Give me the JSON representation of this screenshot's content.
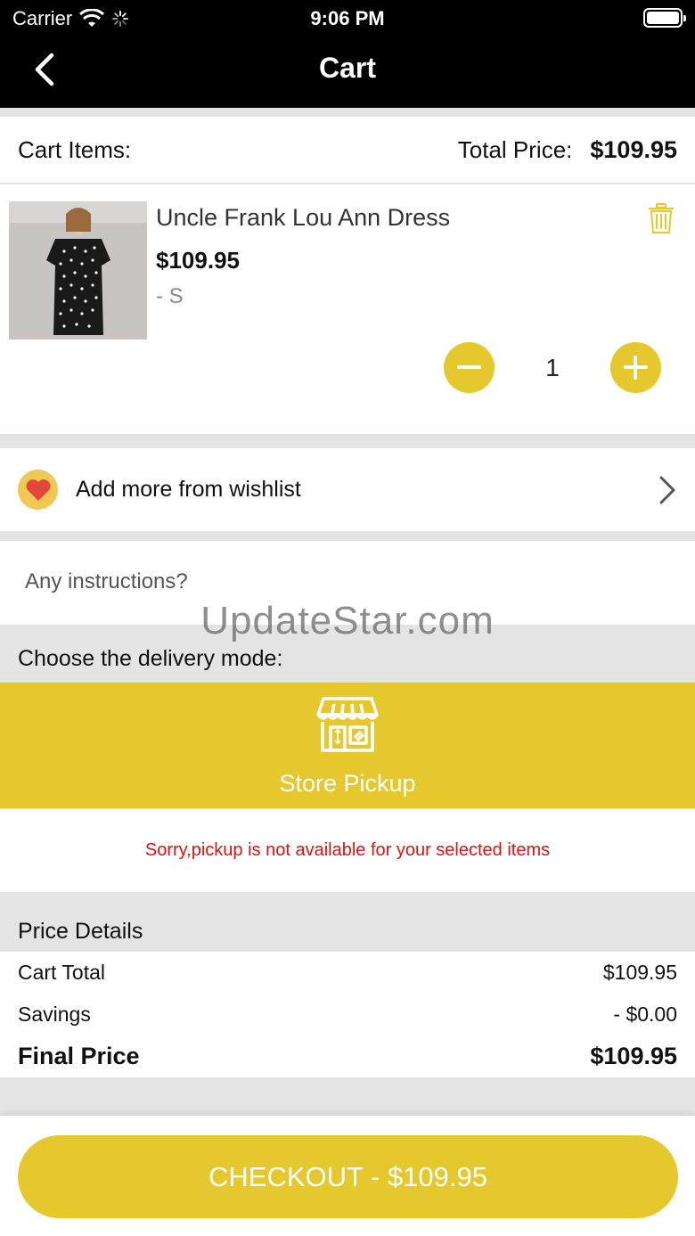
{
  "status_bar": {
    "carrier": "Carrier",
    "time": "9:06 PM"
  },
  "nav": {
    "title": "Cart"
  },
  "cart_header": {
    "label": "Cart Items:",
    "total_label": "Total Price:",
    "total_value": "$109.95"
  },
  "item": {
    "name": "Uncle Frank Lou Ann Dress",
    "price": "$109.95",
    "variant": "- S",
    "quantity": "1"
  },
  "wishlist": {
    "label": "Add more from wishlist"
  },
  "instructions": {
    "placeholder": "Any instructions?"
  },
  "watermark": "UpdateStar.com",
  "delivery": {
    "label": "Choose the delivery mode:",
    "option": "Store Pickup",
    "notice": "Sorry,pickup is not available for your selected items"
  },
  "price_details": {
    "title": "Price Details",
    "rows": [
      {
        "label": "Cart Total",
        "value": "$109.95"
      },
      {
        "label": "Savings",
        "value": "- $0.00"
      },
      {
        "label": "Final Price",
        "value": "$109.95"
      }
    ]
  },
  "checkout": {
    "label": "CHECKOUT - $109.95"
  },
  "colors": {
    "accent": "#e5c72e",
    "error": "#e31010",
    "nav_bg": "#000000"
  }
}
